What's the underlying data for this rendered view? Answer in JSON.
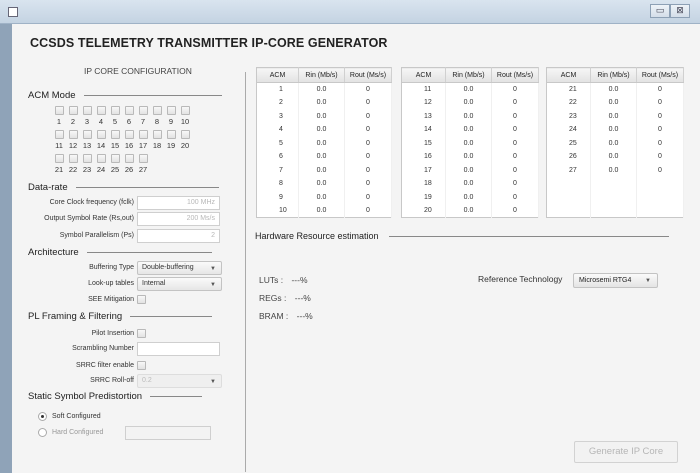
{
  "window": {
    "controls": [
      "▭",
      "⊠"
    ]
  },
  "app_title": "CCSDS TELEMETRY TRANSMITTER IP-CORE GENERATOR",
  "config": {
    "panel_title": "IP CORE CONFIGURATION",
    "acm_mode": {
      "heading": "ACM Mode",
      "rows": [
        [
          "1",
          "2",
          "3",
          "4",
          "5",
          "6",
          "7",
          "8",
          "9",
          "10"
        ],
        [
          "11",
          "12",
          "13",
          "14",
          "15",
          "16",
          "17",
          "18",
          "19",
          "20"
        ],
        [
          "21",
          "22",
          "23",
          "24",
          "25",
          "26",
          "27"
        ]
      ]
    },
    "data_rate": {
      "heading": "Data-rate",
      "core_clock_label": "Core Clock frequency (fclk)",
      "core_clock_placeholder": "100 MHz",
      "output_rate_label": "Output Symbol Rate (Rs,out)",
      "output_rate_placeholder": "200 Ms/s",
      "parallelism_label": "Symbol Parallelism (Ps)",
      "parallelism_placeholder": "2"
    },
    "architecture": {
      "heading": "Architecture",
      "buffering_label": "Buffering Type",
      "buffering_value": "Double-buffering",
      "lookup_label": "Look-up tables",
      "lookup_value": "Internal",
      "see_label": "SEE Mitigation"
    },
    "pl_framing": {
      "heading": "PL Framing & Filtering",
      "pilot_label": "Pilot Insertion",
      "scrambling_label": "Scrambling Number",
      "srrc_enable_label": "SRRC filter enable",
      "srrc_rolloff_label": "SRRC Roll-off",
      "srrc_rolloff_value": "0.2"
    },
    "predistortion": {
      "heading": "Static Symbol Predistortion",
      "soft_label": "Soft Configured",
      "hard_label": "Hard Configured"
    }
  },
  "tables": {
    "headers": [
      "ACM",
      "Rin (Mb/s)",
      "Rout (Ms/s)"
    ],
    "table1": [
      [
        "1",
        "0.0",
        "0"
      ],
      [
        "2",
        "0.0",
        "0"
      ],
      [
        "3",
        "0.0",
        "0"
      ],
      [
        "4",
        "0.0",
        "0"
      ],
      [
        "5",
        "0.0",
        "0"
      ],
      [
        "6",
        "0.0",
        "0"
      ],
      [
        "7",
        "0.0",
        "0"
      ],
      [
        "8",
        "0.0",
        "0"
      ],
      [
        "9",
        "0.0",
        "0"
      ],
      [
        "10",
        "0.0",
        "0"
      ]
    ],
    "table2": [
      [
        "11",
        "0.0",
        "0"
      ],
      [
        "12",
        "0.0",
        "0"
      ],
      [
        "13",
        "0.0",
        "0"
      ],
      [
        "14",
        "0.0",
        "0"
      ],
      [
        "15",
        "0.0",
        "0"
      ],
      [
        "16",
        "0.0",
        "0"
      ],
      [
        "17",
        "0.0",
        "0"
      ],
      [
        "18",
        "0.0",
        "0"
      ],
      [
        "19",
        "0.0",
        "0"
      ],
      [
        "20",
        "0.0",
        "0"
      ]
    ],
    "table3": [
      [
        "21",
        "0.0",
        "0"
      ],
      [
        "22",
        "0.0",
        "0"
      ],
      [
        "23",
        "0.0",
        "0"
      ],
      [
        "24",
        "0.0",
        "0"
      ],
      [
        "25",
        "0.0",
        "0"
      ],
      [
        "26",
        "0.0",
        "0"
      ],
      [
        "27",
        "0.0",
        "0"
      ]
    ]
  },
  "hardware": {
    "heading": "Hardware Resource estimation",
    "luts_label": "LUTs :",
    "luts_value": "---%",
    "regs_label": "REGs :",
    "regs_value": "---%",
    "bram_label": "BRAM :",
    "bram_value": "---%",
    "ref_tech_label": "Reference Technology",
    "ref_tech_value": "Microsemi RTG4"
  },
  "generate_button": "Generate IP Core"
}
